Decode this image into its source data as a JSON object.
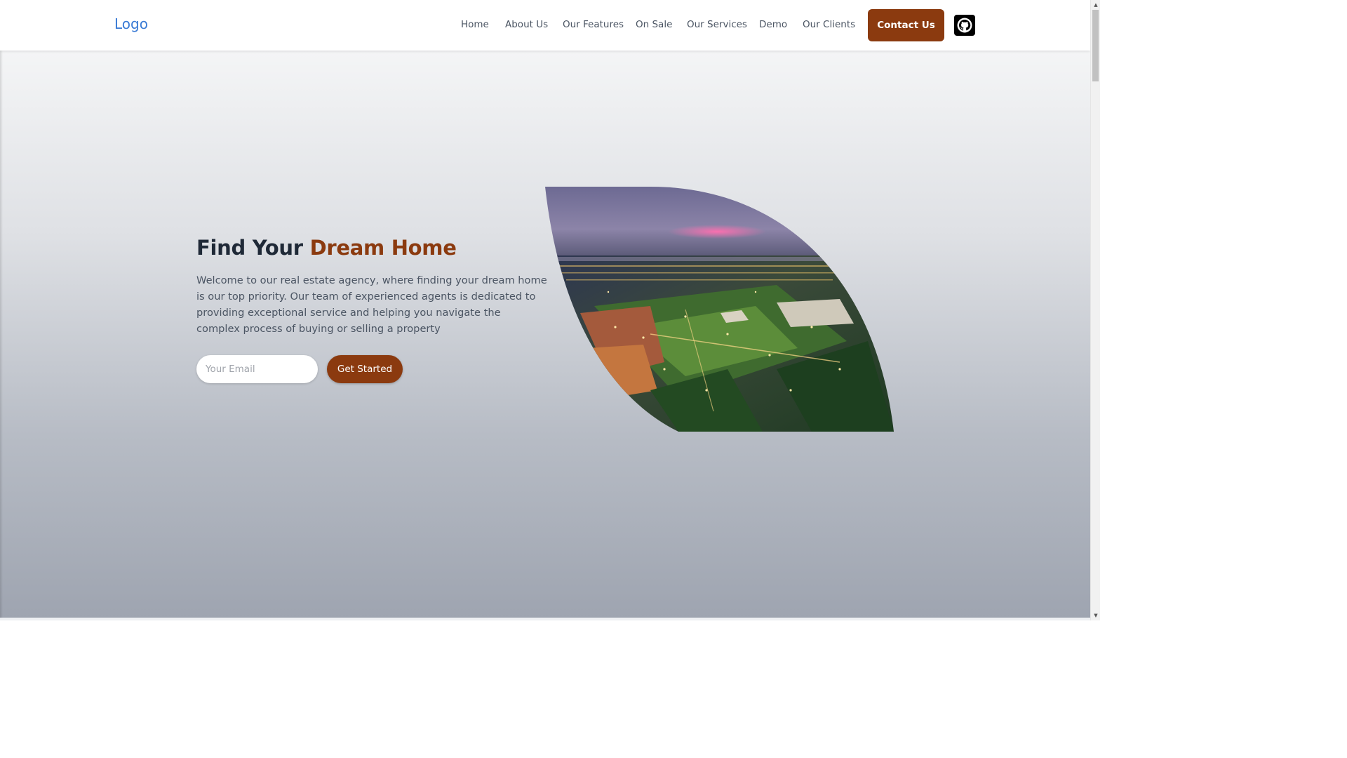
{
  "header": {
    "logo": "Logo",
    "nav": [
      {
        "label": "Home"
      },
      {
        "label": "About Us"
      },
      {
        "label": "Our Features"
      },
      {
        "label": "On Sale"
      },
      {
        "label": "Our Services"
      },
      {
        "label": "Demo"
      },
      {
        "label": "Our Clients"
      }
    ],
    "contact_label": "Contact Us",
    "github_icon": "github-icon"
  },
  "hero": {
    "title_prefix": "Find Your",
    "title_accent": "Dream Home",
    "description": "Welcome to our real estate agency, where finding your dream home is our top priority. Our team of experienced agents is dedicated to providing exceptional service and helping you navigate the complex process of buying or selling a property",
    "email_placeholder": "Your Email",
    "email_value": "",
    "cta_label": "Get Started",
    "image_icon": "aerial-city-night-image"
  },
  "colors": {
    "accent": "#8b3a0f",
    "logo": "#3a7bd5",
    "heading": "#1f2937",
    "body_text": "#4b5563"
  }
}
